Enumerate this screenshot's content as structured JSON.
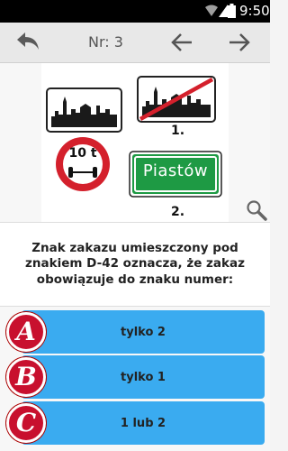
{
  "status_bar": {
    "time": "9:50"
  },
  "action_bar": {
    "question_number": "Nr: 3"
  },
  "signs": {
    "sign1_label": "1.",
    "sign2_label": "2.",
    "weight_limit": "10 t",
    "town_name": "Piastów"
  },
  "question": {
    "text": "Znak zakazu umieszczony pod znakiem D-42 oznacza, że zakaz obowiązuje do znaku numer:"
  },
  "answers": [
    {
      "letter": "A",
      "text": "tylko 2"
    },
    {
      "letter": "B",
      "text": "tylko 1"
    },
    {
      "letter": "C",
      "text": "1 lub 2"
    }
  ],
  "colors": {
    "answer_bg": "#3aabf0",
    "badge_red": "#c8102e",
    "town_sign_green": "#1e9a44"
  }
}
